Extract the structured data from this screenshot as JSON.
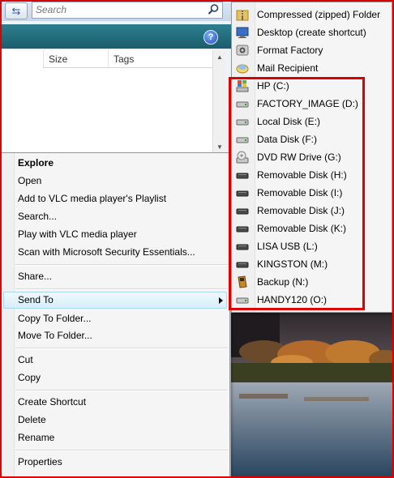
{
  "search": {
    "placeholder": "Search"
  },
  "file_list": {
    "columns": [
      "Size",
      "Tags"
    ]
  },
  "help_label": "?",
  "context_menu": {
    "items": [
      {
        "label": "Explore",
        "bold": true
      },
      {
        "label": "Open"
      },
      {
        "label": "Add to VLC media player's Playlist"
      },
      {
        "label": "Search..."
      },
      {
        "label": "Play with VLC media player"
      },
      {
        "label": "Scan with Microsoft Security Essentials..."
      },
      {
        "label": "Share..."
      },
      {
        "label": "Send To",
        "submenu": true,
        "highlighted": true
      },
      {
        "label": "Copy To Folder..."
      },
      {
        "label": "Move To Folder..."
      },
      {
        "label": "Cut"
      },
      {
        "label": "Copy"
      },
      {
        "label": "Create Shortcut"
      },
      {
        "label": "Delete"
      },
      {
        "label": "Rename"
      },
      {
        "label": "Properties"
      }
    ]
  },
  "send_to": {
    "items": [
      {
        "label": "Compressed (zipped) Folder",
        "icon": "zip-folder-icon"
      },
      {
        "label": "Desktop (create shortcut)",
        "icon": "desktop-icon"
      },
      {
        "label": "Format Factory",
        "icon": "format-factory-icon"
      },
      {
        "label": "Mail Recipient",
        "icon": "mail-icon"
      },
      {
        "label": "HP (C:)",
        "icon": "windows-drive-icon"
      },
      {
        "label": "FACTORY_IMAGE (D:)",
        "icon": "hard-drive-icon"
      },
      {
        "label": "Local Disk (E:)",
        "icon": "hard-drive-icon"
      },
      {
        "label": "Data Disk (F:)",
        "icon": "hard-drive-icon"
      },
      {
        "label": "DVD RW Drive (G:)",
        "icon": "dvd-drive-icon"
      },
      {
        "label": "Removable Disk (H:)",
        "icon": "removable-drive-icon"
      },
      {
        "label": "Removable Disk (I:)",
        "icon": "removable-drive-icon"
      },
      {
        "label": "Removable Disk (J:)",
        "icon": "removable-drive-icon"
      },
      {
        "label": "Removable Disk (K:)",
        "icon": "removable-drive-icon"
      },
      {
        "label": "LISA USB (L:)",
        "icon": "removable-drive-icon"
      },
      {
        "label": "KINGSTON (M:)",
        "icon": "removable-drive-icon"
      },
      {
        "label": "Backup (N:)",
        "icon": "backup-drive-icon"
      },
      {
        "label": "HANDY120 (O:)",
        "icon": "hard-drive-icon"
      }
    ]
  },
  "colors": {
    "highlight_border": "#d90000",
    "menu_background": "#f5f5f5",
    "command_bar": "#1b5d6c"
  }
}
